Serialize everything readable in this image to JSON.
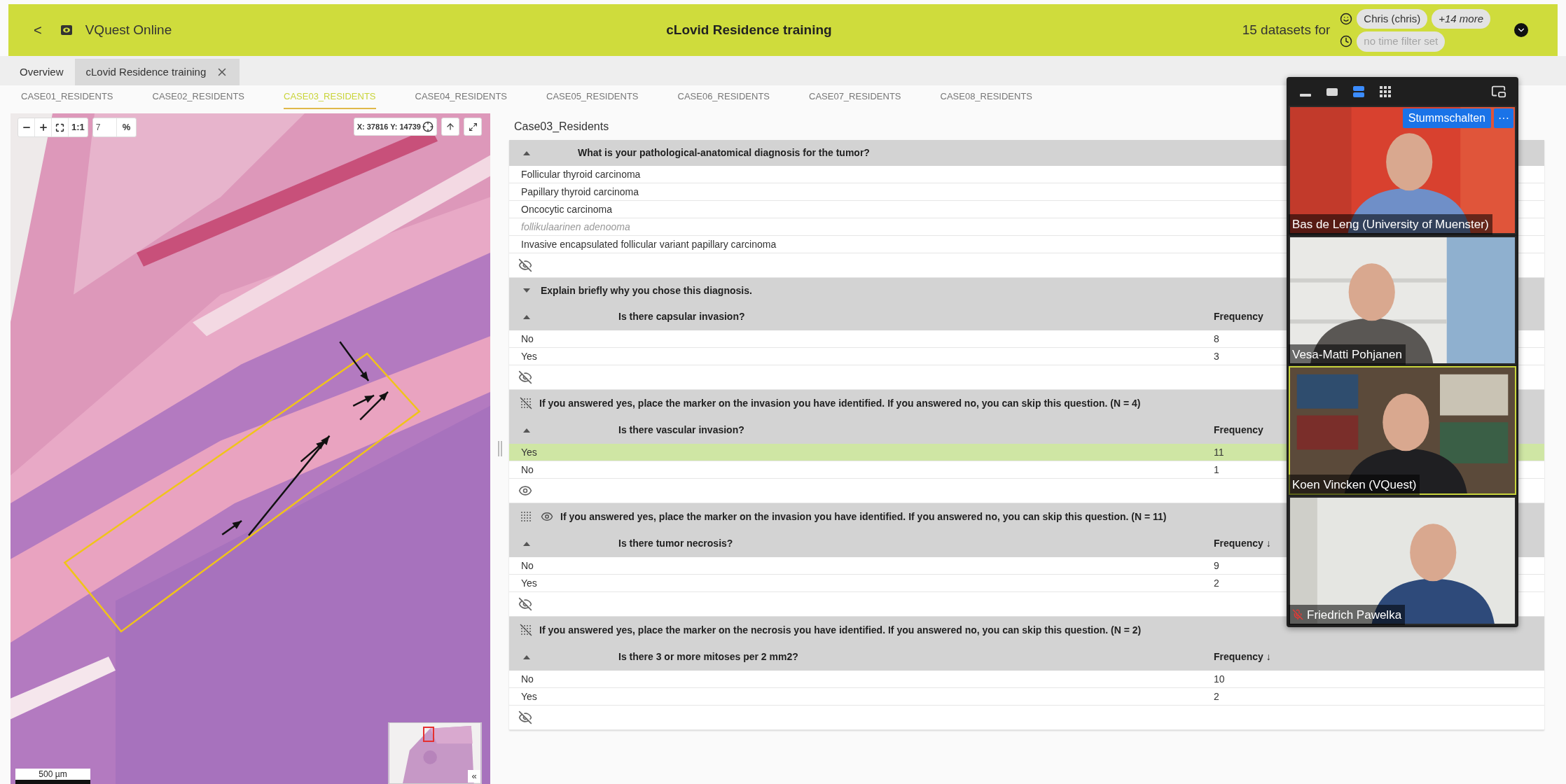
{
  "app_bar": {
    "back": "<",
    "title": "VQuest Online",
    "heading": "cLovid Residence training",
    "datasets_label": "15 datasets for",
    "user": "Chris (chris)",
    "more": "+14 more",
    "time_filter": "no time filter set"
  },
  "tabs": [
    {
      "label": "Overview",
      "selected": false,
      "closable": false
    },
    {
      "label": "cLovid Residence training",
      "selected": true,
      "closable": true
    }
  ],
  "case_tabs": [
    {
      "label": "CASE01_RESIDENTS",
      "selected": false
    },
    {
      "label": "CASE02_RESIDENTS",
      "selected": false
    },
    {
      "label": "CASE03_RESIDENTS",
      "selected": true
    },
    {
      "label": "CASE04_RESIDENTS",
      "selected": false
    },
    {
      "label": "CASE05_RESIDENTS",
      "selected": false
    },
    {
      "label": "CASE06_RESIDENTS",
      "selected": false
    },
    {
      "label": "CASE07_RESIDENTS",
      "selected": false
    },
    {
      "label": "CASE08_RESIDENTS",
      "selected": false
    }
  ],
  "viewer": {
    "one_to_one": "1:1",
    "zoom_value": "7",
    "zoom_unit": "%",
    "coordinates": "X: 37816 Y: 14739",
    "scale_bar": "500 µm",
    "overview_toggle": "«"
  },
  "panel": {
    "title": "Case03_Residents",
    "sections": [
      {
        "kind": "choice",
        "question": "What is your pathological-anatomical diagnosis for the tumor?",
        "expanded": true,
        "visible": false,
        "options": [
          {
            "text": "Follicular thyroid carcinoma",
            "custom": false
          },
          {
            "text": "Papillary thyroid carcinoma",
            "custom": false
          },
          {
            "text": "Oncocytic carcinoma",
            "custom": false
          },
          {
            "text": "follikulaarinen adenooma",
            "custom": true
          },
          {
            "text": "Invasive encapsulated follicular variant papillary carcinoma",
            "custom": false
          }
        ]
      },
      {
        "kind": "text",
        "question": "Explain briefly why you chose this diagnosis.",
        "expanded": false
      },
      {
        "kind": "frequency",
        "question": "Is there capsular invasion?",
        "column": "Frequency",
        "visible": false,
        "rows": [
          {
            "answer": "No",
            "count": "8",
            "selected": false
          },
          {
            "answer": "Yes",
            "count": "3",
            "selected": false
          }
        ]
      },
      {
        "kind": "marker",
        "question": "If you answered yes, place the marker on the invasion you have identified. If you answered no, you can skip this question. (N = 4)",
        "markers_shown": false
      },
      {
        "kind": "frequency",
        "question": "Is there vascular invasion?",
        "column": "Frequency",
        "visible": true,
        "rows": [
          {
            "answer": "Yes",
            "count": "11",
            "selected": true
          },
          {
            "answer": "No",
            "count": "1",
            "selected": false
          }
        ]
      },
      {
        "kind": "marker",
        "question": "If you answered yes, place the marker on the invasion you have identified. If you answered no, you can skip this question. (N = 11)",
        "markers_shown": true
      },
      {
        "kind": "frequency",
        "question": "Is there tumor necrosis?",
        "column": "Frequency ↓",
        "visible": false,
        "rows": [
          {
            "answer": "No",
            "count": "9",
            "selected": false
          },
          {
            "answer": "Yes",
            "count": "2",
            "selected": false
          }
        ]
      },
      {
        "kind": "marker",
        "question": "If you answered yes, place the marker on the necrosis you have identified. If you answered no, you can skip this question. (N = 2)",
        "markers_shown": false
      },
      {
        "kind": "frequency",
        "question": "Is there 3 or more mitoses per 2 mm2?",
        "column": "Frequency ↓",
        "visible": false,
        "rows": [
          {
            "answer": "No",
            "count": "10",
            "selected": false
          },
          {
            "answer": "Yes",
            "count": "2",
            "selected": false
          }
        ]
      }
    ]
  },
  "video_call": {
    "mute_button": "Stummschalten",
    "more_button": "···",
    "layouts": [
      {
        "kind": "minimize",
        "selected": false
      },
      {
        "kind": "single",
        "selected": false
      },
      {
        "kind": "stack",
        "selected": true
      },
      {
        "kind": "grid",
        "selected": false
      }
    ],
    "tiles": [
      {
        "name": "Bas de Leng (University of Muenster)",
        "kind": "red_wall",
        "muted": false,
        "speaking": false
      },
      {
        "name": "Vesa-Matti Pohjanen",
        "kind": "shelf",
        "muted": false,
        "speaking": false
      },
      {
        "name": "Koen Vincken (VQuest)",
        "kind": "books",
        "muted": false,
        "speaking": true
      },
      {
        "name": "Friedrich Pawelka",
        "kind": "plain",
        "muted": true,
        "speaking": false
      }
    ]
  }
}
